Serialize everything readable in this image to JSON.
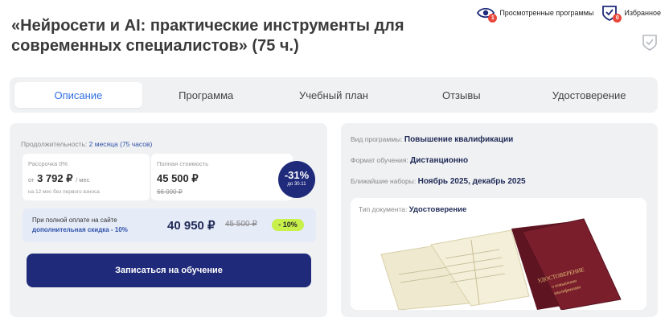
{
  "header": {
    "title": "«Нейросети и AI: практические инструменты для современных специалистов» (75 ч.)",
    "viewed_label": "Просмотренные программы",
    "viewed_count": "1",
    "favorites_label": "Избранное",
    "favorites_count": "0"
  },
  "tabs": [
    {
      "label": "Описание",
      "active": true
    },
    {
      "label": "Программа",
      "active": false
    },
    {
      "label": "Учебный план",
      "active": false
    },
    {
      "label": "Отзывы",
      "active": false
    },
    {
      "label": "Удостоверение",
      "active": false
    }
  ],
  "pricing": {
    "duration_label": "Продолжительность:",
    "duration_value": "2 месяца (75 часов)",
    "installment_label": "Рассрочка 0%",
    "installment_prefix": "от",
    "installment_price": "3 792 ₽",
    "installment_unit": "/ мес",
    "installment_note": "на 12 мес без первого взноса",
    "full_label": "Полная стоимость",
    "full_price": "45 500 ₽",
    "full_old_price": "66 000 ₽",
    "discount_pct": "-31%",
    "discount_until": "до 30.11",
    "full_pay_text": "При полной оплате на сайте",
    "full_pay_discount_text": "дополнительная скидка - 10%",
    "full_pay_price": "40 950 ₽",
    "full_pay_old_price": "45 500 ₽",
    "full_pay_tag": "- 10%",
    "enroll_button": "Записаться на обучение"
  },
  "info": {
    "type_label": "Вид программы:",
    "type_value": "Повышение квалификации",
    "format_label": "Формат обучения:",
    "format_value": "Дистанционно",
    "nearest_label": "Ближайшие наборы:",
    "nearest_value": "Ноябрь 2025, декабрь 2025",
    "doc_label": "Тип документа:",
    "doc_value": "Удостоверение",
    "cert_cover_line1": "УДОСТОВЕРЕНИЕ",
    "cert_cover_line2": "о повышении",
    "cert_cover_line3": "квалификации"
  },
  "colors": {
    "accent_blue": "#2f6fe0",
    "navy": "#1f2a7a",
    "badge_red": "#e8463a",
    "lime": "#c7f04a",
    "panel_bg": "#f0f1f3",
    "cover_maroon": "#7a1e2c"
  }
}
